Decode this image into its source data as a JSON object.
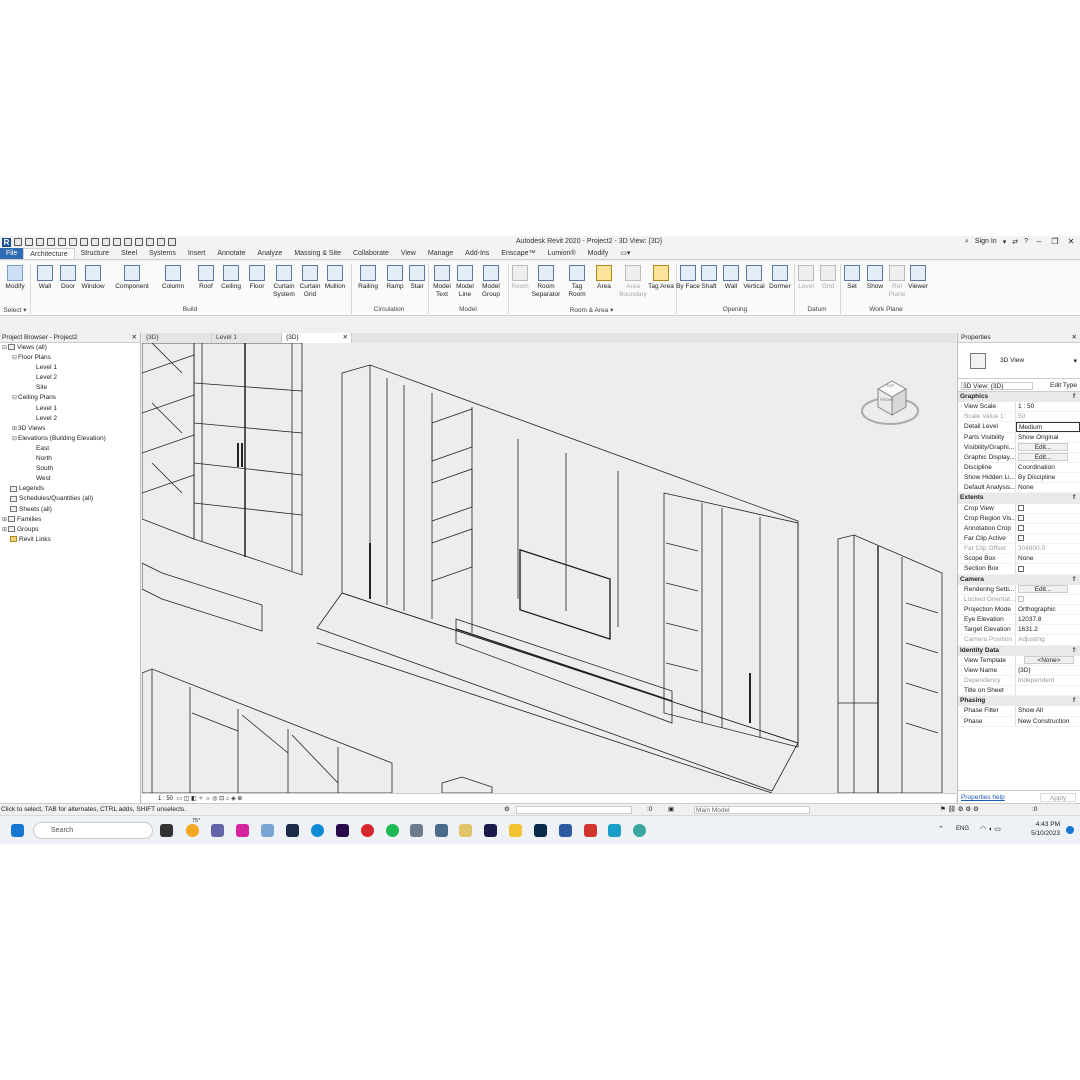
{
  "titlebar": {
    "app_title": "Autodesk Revit 2020 - Project2 - 3D View: {3D}",
    "sign_in": "Sign In"
  },
  "ribbon_tabs": [
    "File",
    "Architecture",
    "Structure",
    "Steel",
    "Systems",
    "Insert",
    "Annotate",
    "Analyze",
    "Massing & Site",
    "Collaborate",
    "View",
    "Manage",
    "Add-Ins",
    "Enscape™",
    "Lumion®",
    "Modify"
  ],
  "ribbon": {
    "select_label": "Select ▾",
    "buttons": [
      {
        "label": "Modify"
      },
      {
        "label": "Wall"
      },
      {
        "label": "Door"
      },
      {
        "label": "Window"
      },
      {
        "label": "Component"
      },
      {
        "label": "Column"
      },
      {
        "label": "Roof"
      },
      {
        "label": "Ceiling"
      },
      {
        "label": "Floor"
      },
      {
        "label": "Curtain System"
      },
      {
        "label": "Curtain Grid"
      },
      {
        "label": "Mullion"
      },
      {
        "label": "Railing"
      },
      {
        "label": "Ramp"
      },
      {
        "label": "Stair"
      },
      {
        "label": "Model Text"
      },
      {
        "label": "Model Line"
      },
      {
        "label": "Model Group"
      },
      {
        "label": "Room"
      },
      {
        "label": "Room Separator"
      },
      {
        "label": "Tag Room"
      },
      {
        "label": "Area"
      },
      {
        "label": "Area Boundary"
      },
      {
        "label": "Tag Area"
      },
      {
        "label": "By Face"
      },
      {
        "label": "Shaft"
      },
      {
        "label": "Wall"
      },
      {
        "label": "Vertical"
      },
      {
        "label": "Dormer"
      },
      {
        "label": "Level"
      },
      {
        "label": "Grid"
      },
      {
        "label": "Set"
      },
      {
        "label": "Show"
      },
      {
        "label": "Ref Plane"
      },
      {
        "label": "Viewer"
      }
    ],
    "groups": [
      "Build",
      "Circulation",
      "Model",
      "Room & Area ▾",
      "Opening",
      "Datum",
      "Work Plane"
    ]
  },
  "project_browser": {
    "title": "Project Browser - Project2",
    "items": [
      {
        "label": "Views (all)"
      },
      {
        "label": "Floor Plans"
      },
      {
        "label": "Level 1"
      },
      {
        "label": "Level 2"
      },
      {
        "label": "Site"
      },
      {
        "label": "Ceiling Plans"
      },
      {
        "label": "Level 1"
      },
      {
        "label": "Level 2"
      },
      {
        "label": "3D Views"
      },
      {
        "label": "Elevations (Building Elevation)"
      },
      {
        "label": "East"
      },
      {
        "label": "North"
      },
      {
        "label": "South"
      },
      {
        "label": "West"
      },
      {
        "label": "Legends"
      },
      {
        "label": "Schedules/Quantities (all)"
      },
      {
        "label": "Sheets (all)"
      },
      {
        "label": "Families"
      },
      {
        "label": "Groups"
      },
      {
        "label": "Revit Links"
      }
    ]
  },
  "view_tabs": [
    "{3D}",
    "Level 1",
    "{3D}"
  ],
  "viewbar": {
    "scale": "1 : 50"
  },
  "viewcube": {
    "top": "TOP",
    "front": "FRONT"
  },
  "properties": {
    "title": "Properties",
    "type_name": "3D View",
    "filter": "3D View: {3D}",
    "edit_type": "Edit Type",
    "groups": {
      "graphics": "Graphics",
      "extents": "Extents",
      "camera": "Camera",
      "identity": "Identity Data",
      "phasing": "Phasing"
    },
    "graphics_rows": [
      {
        "k": "View Scale",
        "v": "1 : 50"
      },
      {
        "k": "Scale Value    1:",
        "v": "50"
      },
      {
        "k": "Detail Level",
        "v": "Medium"
      },
      {
        "k": "Parts Visibility",
        "v": "Show Original"
      },
      {
        "k": "Visibility/Graphi...",
        "v": "Edit..."
      },
      {
        "k": "Graphic Display...",
        "v": "Edit..."
      },
      {
        "k": "Discipline",
        "v": "Coordination"
      },
      {
        "k": "Show Hidden Li...",
        "v": "By Discipline"
      },
      {
        "k": "Default Analysis...",
        "v": "None"
      }
    ],
    "extents_rows": [
      {
        "k": "Crop View",
        "v": ""
      },
      {
        "k": "Crop Region Vis...",
        "v": ""
      },
      {
        "k": "Annotation Crop",
        "v": ""
      },
      {
        "k": "Far Clip Active",
        "v": ""
      },
      {
        "k": "Far Clip Offset",
        "v": "304800.0"
      },
      {
        "k": "Scope Box",
        "v": "None"
      },
      {
        "k": "Section Box",
        "v": ""
      }
    ],
    "camera_rows": [
      {
        "k": "Rendering Setti...",
        "v": "Edit..."
      },
      {
        "k": "Locked Orientat...",
        "v": ""
      },
      {
        "k": "Projection Mode",
        "v": "Orthographic"
      },
      {
        "k": "Eye Elevation",
        "v": "12037.8"
      },
      {
        "k": "Target Elevation",
        "v": "1631.2"
      },
      {
        "k": "Camera Position",
        "v": "Adjusting"
      }
    ],
    "identity_rows": [
      {
        "k": "View Template",
        "v": "<None>"
      },
      {
        "k": "View Name",
        "v": "{3D}"
      },
      {
        "k": "Dependency",
        "v": "Independent"
      },
      {
        "k": "Title on Sheet",
        "v": ""
      }
    ],
    "phasing_rows": [
      {
        "k": "Phase Filter",
        "v": "Show All"
      },
      {
        "k": "Phase",
        "v": "New Construction"
      }
    ],
    "help_link": "Properties help",
    "apply": "Apply"
  },
  "statusbar": {
    "hint": "Click to select, TAB for alternates, CTRL adds, SHIFT unselects.",
    "coord": ":0",
    "model": "Main Model",
    "filter_count": ":0"
  },
  "taskbar": {
    "search": "Search",
    "weather": "75°",
    "lang": "ENG",
    "time": "4:43 PM",
    "date": "5/10/2023"
  },
  "colors": {
    "file_tab": "#2f6db3",
    "revit_blue": "#1b4f8f",
    "canvas": "#ededed"
  }
}
